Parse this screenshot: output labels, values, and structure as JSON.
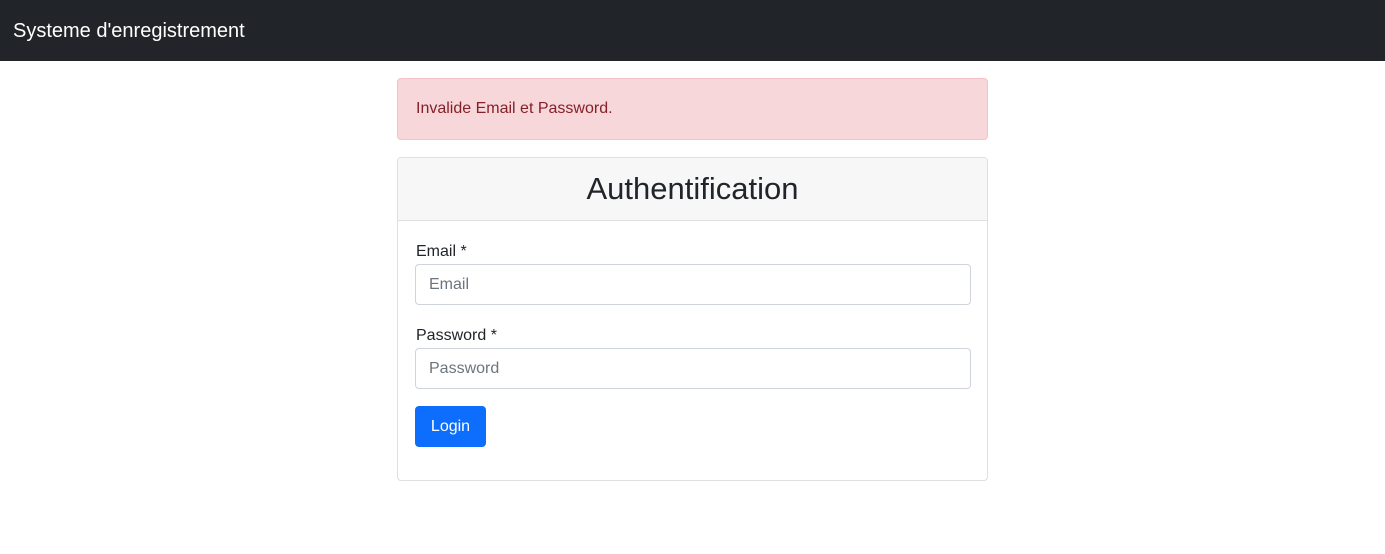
{
  "navbar": {
    "brand": "Systeme d'enregistrement"
  },
  "alert": {
    "message": "Invalide Email et Password.",
    "type": "danger"
  },
  "login_card": {
    "title": "Authentification",
    "email": {
      "label": "Email *",
      "placeholder": "Email",
      "value": ""
    },
    "password": {
      "label": "Password *",
      "placeholder": "Password",
      "value": ""
    },
    "submit_label": "Login"
  },
  "colors": {
    "navbar_bg": "#212529",
    "alert_bg": "#f8d7da",
    "alert_text": "#842029",
    "primary": "#0d6efd"
  }
}
